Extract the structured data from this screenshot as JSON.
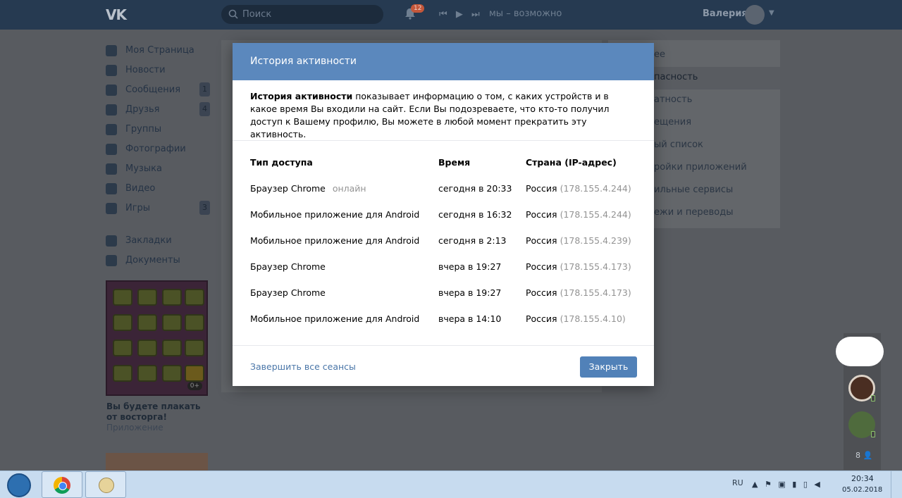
{
  "topbar": {
    "logo": "VK",
    "search_placeholder": "Поиск",
    "notifications_count": "12",
    "track": "мы – возможно",
    "username": "Валерия"
  },
  "leftnav": {
    "items": [
      {
        "label": "Моя Страница",
        "count": ""
      },
      {
        "label": "Новости",
        "count": ""
      },
      {
        "label": "Сообщения",
        "count": "1"
      },
      {
        "label": "Друзья",
        "count": "4"
      },
      {
        "label": "Группы",
        "count": ""
      },
      {
        "label": "Фотографии",
        "count": ""
      },
      {
        "label": "Музыка",
        "count": ""
      },
      {
        "label": "Видео",
        "count": ""
      },
      {
        "label": "Игры",
        "count": "3"
      }
    ],
    "extra_items": [
      {
        "label": "Закладки"
      },
      {
        "label": "Документы"
      }
    ],
    "promo": {
      "age": "0+",
      "title": "Вы будете плакать от восторга!",
      "subtitle": "Приложение"
    }
  },
  "rightmenu": {
    "items": [
      "ее",
      "пасность",
      "атность",
      "ещения",
      "ый список",
      "ройки приложений",
      "ильные сервисы",
      "ежи и переводы"
    ],
    "active_index": 1
  },
  "modal": {
    "title": "История активности",
    "intro_bold": "История активности",
    "intro_rest": " показывает информацию о том, с каких устройств и в какое время Вы входили на сайт. Если Вы подозреваете, что кто-то получил доступ к Вашему профилю, Вы можете в любой момент прекратить эту активность.",
    "headers": {
      "access": "Тип доступа",
      "time": "Время",
      "country": "Страна (IP-адрес)"
    },
    "rows": [
      {
        "access": "Браузер Chrome",
        "status": "онлайн",
        "time": "сегодня в 20:33",
        "country": "Россия",
        "ip": "(178.155.4.244)"
      },
      {
        "access": "Мобильное приложение для Android",
        "status": "",
        "time": "сегодня в 16:32",
        "country": "Россия",
        "ip": "(178.155.4.244)"
      },
      {
        "access": "Мобильное приложение для Android",
        "status": "",
        "time": "сегодня в 2:13",
        "country": "Россия",
        "ip": "(178.155.4.239)"
      },
      {
        "access": "Браузер Chrome",
        "status": "",
        "time": "вчера в 19:27",
        "country": "Россия",
        "ip": "(178.155.4.173)"
      },
      {
        "access": "Браузер Chrome",
        "status": "",
        "time": "вчера в 19:27",
        "country": "Россия",
        "ip": "(178.155.4.173)"
      },
      {
        "access": "Мобильное приложение для Android",
        "status": "",
        "time": "вчера в 14:10",
        "country": "Россия",
        "ip": "(178.155.4.10)"
      }
    ],
    "end_sessions": "Завершить все сеансы",
    "close": "Закрыть"
  },
  "chatbar": {
    "online_count": "8"
  },
  "taskbar": {
    "lang": "RU",
    "time": "20:34",
    "date": "05.02.2018"
  },
  "colors": {
    "topbar": "#263a51",
    "modal_header": "#5b88bd",
    "button": "#5181b8",
    "link": "#4a76a8"
  }
}
